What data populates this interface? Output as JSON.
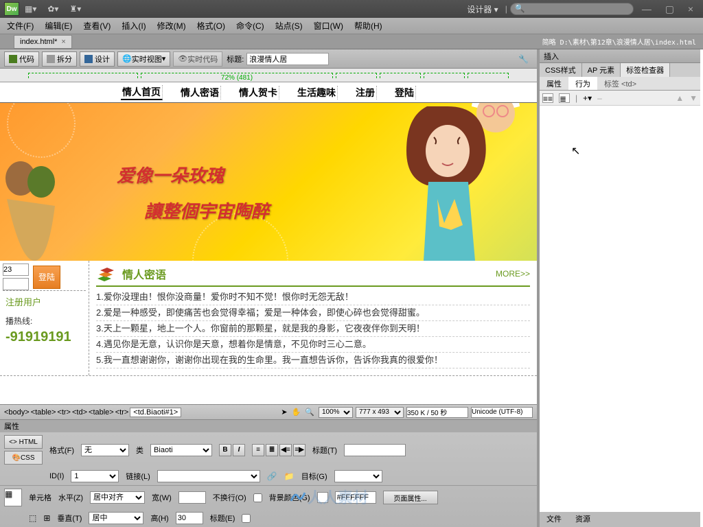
{
  "app": {
    "workspace": "设计器",
    "logo": "Dw"
  },
  "menus": [
    "文件(F)",
    "编辑(E)",
    "查看(V)",
    "插入(I)",
    "修改(M)",
    "格式(O)",
    "命令(C)",
    "站点(S)",
    "窗口(W)",
    "帮助(H)"
  ],
  "doc_tab": {
    "name": "index.html*",
    "path": "简略  D:\\素材\\第12章\\浪漫情人居\\index.html"
  },
  "view_toolbar": {
    "code": "代码",
    "split": "拆分",
    "design": "设计",
    "live_view": "实时视图",
    "live_code": "实时代码",
    "title_label": "标题:",
    "title_value": "浪漫情人居"
  },
  "ruler": {
    "center_label": "72% (481)"
  },
  "page": {
    "nav": [
      "情人首页",
      "情人密语",
      "情人贺卡",
      "生活趣味",
      "注册",
      "登陆"
    ],
    "banner_line1": "爱像一朵玫瑰",
    "banner_line2": "讓整個宇宙陶醉",
    "login_val": "23",
    "login_btn": "登陆",
    "reg_user": "注册用户",
    "hotline_label": "播热线:",
    "hotline": "-91919191",
    "section_title": "情人密语",
    "more": "MORE>>",
    "quotes": [
      "1.爱你没理由！恨你没商量！爱你时不知不觉！恨你时无怨无敌！",
      "2.爱是一种感受，即使痛苦也会觉得幸福；爱是一种体会，即使心碎也会觉得甜蜜。",
      "3.天上一颗星，地上一个人。你窗前的那颗星，就是我的身影，它夜夜伴你到天明！",
      "4.遇见你是无意，认识你是天意，想着你是情意，不见你时三心二意。",
      "5.我一直想谢谢你，谢谢你出现在我的生命里。我一直想告诉你，告诉你我真的很爱你！"
    ]
  },
  "tag_path": [
    "<body>",
    "<table>",
    "<tr>",
    "<td>",
    "<table>",
    "<tr>",
    "<td.Biaoti#1>"
  ],
  "status": {
    "zoom": "100%",
    "dims": "777 x 493",
    "size": "350 K / 50 秒",
    "encoding": "Unicode (UTF-8)"
  },
  "properties": {
    "tab": "属性",
    "html_btn": "<> HTML",
    "css_btn": "CSS",
    "format_lbl": "格式(F)",
    "format_val": "无",
    "class_lbl": "类",
    "class_val": "Biaoti",
    "id_lbl": "ID(I)",
    "id_val": "1",
    "link_lbl": "链接(L)",
    "title_lbl": "标题(T)",
    "target_lbl": "目标(G)",
    "cell_lbl": "单元格",
    "halign_lbl": "水平(Z)",
    "halign_val": "居中对齐",
    "valign_lbl": "垂直(T)",
    "valign_val": "居中",
    "width_lbl": "宽(W)",
    "width_val": "",
    "height_lbl": "高(H)",
    "height_val": "30",
    "nowrap_lbl": "不换行(O)",
    "header_lbl": "标题(E)",
    "bg_lbl": "背景颜色(G)",
    "bg_val": "#FFFFFF",
    "page_props": "页面属性..."
  },
  "right": {
    "insert": "插入",
    "tabs1": [
      "CSS样式",
      "AP 元素",
      "标签检查器"
    ],
    "tabs2": [
      "属性",
      "行为"
    ],
    "tag_label": "标签 <td>",
    "footer": [
      "文件",
      "资源"
    ]
  },
  "watermark": "人人素材"
}
